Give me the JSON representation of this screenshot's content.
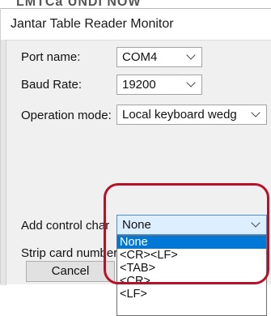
{
  "background": {
    "fragment": "LMTCa UNDI NOW"
  },
  "window": {
    "title": "Jantar Table Reader Monitor"
  },
  "form": {
    "port_name": {
      "label": "Port name:",
      "value": "COM4"
    },
    "baud_rate": {
      "label": "Baud Rate:",
      "value": "19200"
    },
    "operation_mode": {
      "label": "Operation mode:",
      "value": "Local keyboard wedg"
    },
    "add_control_chars": {
      "label": "Add control char",
      "value": "None"
    },
    "strip_card_number": {
      "label": "Strip card number"
    }
  },
  "dropdown": {
    "options": [
      "None",
      "<CR><LF>",
      "<TAB>",
      "<CR>",
      "<LF>"
    ],
    "selected_index": 0
  },
  "buttons": {
    "cancel": "Cancel"
  },
  "colors": {
    "highlight": "#b5122a",
    "selection": "#0078d7"
  }
}
